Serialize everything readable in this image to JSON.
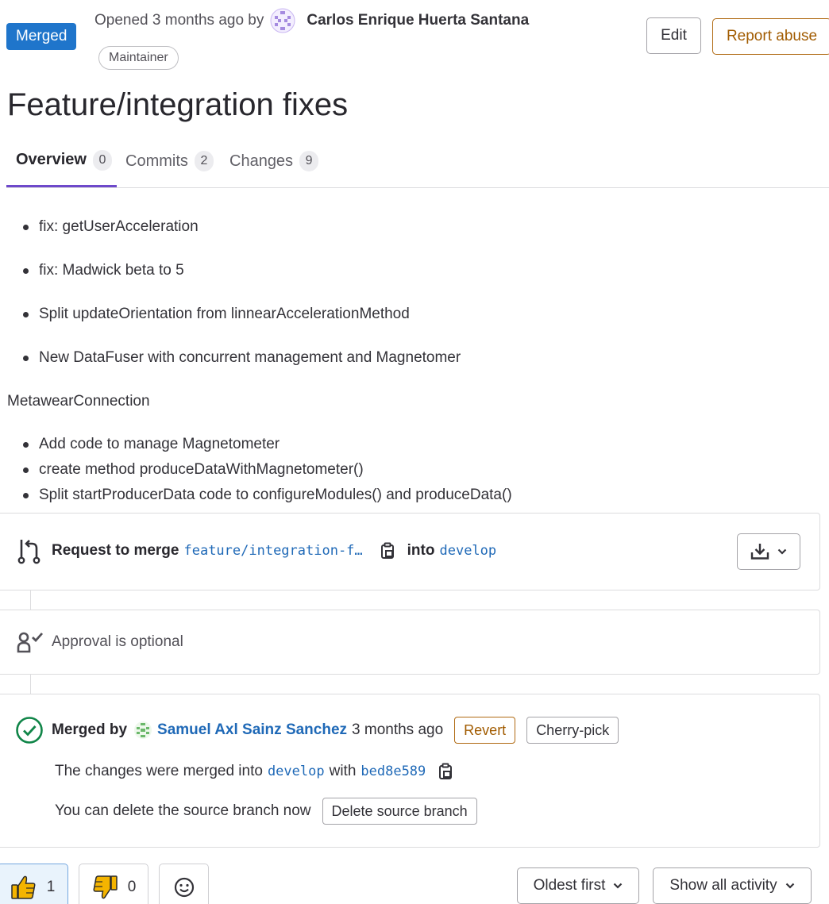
{
  "header": {
    "status_badge": "Merged",
    "opened_text": "Opened 3 months ago by",
    "author": "Carlos Enrique Huerta Santana",
    "author_role": "Maintainer",
    "edit_label": "Edit",
    "report_label": "Report abuse"
  },
  "title": "Feature/integration fixes",
  "tabs": [
    {
      "label": "Overview",
      "count": "0",
      "active": true
    },
    {
      "label": "Commits",
      "count": "2"
    },
    {
      "label": "Changes",
      "count": "9"
    }
  ],
  "description": {
    "bullets_top": [
      "fix: getUserAcceleration",
      "fix: Madwick beta to 5",
      "Split updateOrientation from linnearAccelerationMethod",
      "New DataFuser with concurrent management and Magnetomer"
    ],
    "paragraph": "MetawearConnection",
    "bullets_bottom": [
      "Add code to manage Magnetometer",
      "create method produceDataWithMagnetometer()",
      "Split startProducerData code to configureModules() and produceData()"
    ]
  },
  "merge_request": {
    "prefix": "Request to merge",
    "source_branch": "feature/integration-f…",
    "into_label": "into",
    "target_branch": "develop"
  },
  "approval": {
    "text": "Approval is optional"
  },
  "merged": {
    "merged_by_label": "Merged by",
    "merged_by_user": "Samuel Axl Sainz Sanchez",
    "time": "3 months ago",
    "revert_label": "Revert",
    "cherry_pick_label": "Cherry-pick",
    "line2_prefix": "The changes were merged into",
    "line2_branch": "develop",
    "line2_with": "with",
    "commit_sha": "bed8e589",
    "line3_text": "You can delete the source branch now",
    "delete_branch_label": "Delete source branch"
  },
  "footer": {
    "thumbs_up_count": "1",
    "thumbs_down_count": "0",
    "sort_label": "Oldest first",
    "filter_label": "Show all activity"
  },
  "colors": {
    "merged_badge": "#1f75cb",
    "link": "#1f69b7",
    "tab_active_underline": "#6e49cb",
    "revert_orange": "#a15b00",
    "success_green": "#108548"
  }
}
